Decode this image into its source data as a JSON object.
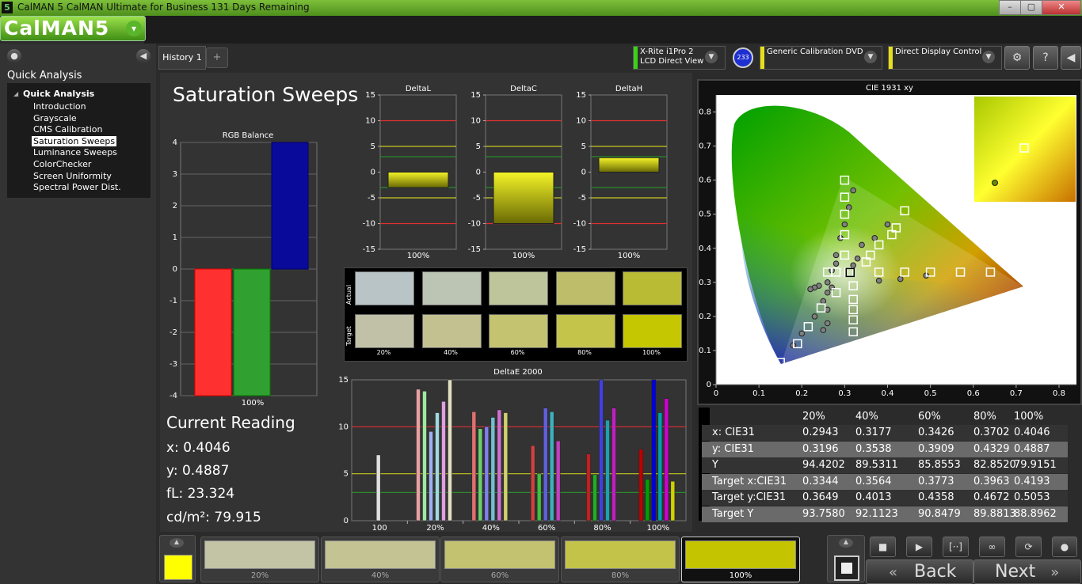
{
  "window": {
    "title": "CalMAN 5 CalMAN Ultimate for Business 131 Days Remaining",
    "app_icon": "5",
    "logo": "CalMAN5"
  },
  "sidebar": {
    "header": "Quick Analysis",
    "tree_root": "Quick Analysis",
    "items": [
      {
        "label": "Introduction"
      },
      {
        "label": "Grayscale"
      },
      {
        "label": "CMS Calibration"
      },
      {
        "label": "Saturation Sweeps",
        "selected": true
      },
      {
        "label": "Luminance Sweeps"
      },
      {
        "label": "ColorChecker"
      },
      {
        "label": "Screen Uniformity"
      },
      {
        "label": "Spectral Power Dist."
      }
    ]
  },
  "tabs": {
    "history": "History 1",
    "add": "+"
  },
  "devices": {
    "meter_line1": "X-Rite i1Pro 2",
    "meter_line2": "LCD Direct View",
    "meter_badge": "233",
    "source": "Generic Calibration DVD",
    "display": "Direct Display Control",
    "meter_color": "#3bd01a",
    "source_color": "#e6e01a",
    "display_color": "#e6e01a"
  },
  "page": {
    "title": "Saturation Sweeps"
  },
  "reading": {
    "title": "Current Reading",
    "x": "x: 0.4046",
    "y": "y: 0.4887",
    "fl": "fL: 23.324",
    "cdm2": "cd/m²: 79.915"
  },
  "rgb_chart": {
    "title": "RGB Balance",
    "ylim": [
      -4,
      4
    ],
    "ticks": [
      "4",
      "3",
      "2",
      "1",
      "0",
      "-1",
      "-2",
      "-3",
      "-4"
    ],
    "category": "100%",
    "values": {
      "red": -4,
      "green": -4,
      "blue": 4
    }
  },
  "delta_charts": {
    "ticks": [
      "15",
      "10",
      "5",
      "0",
      "-5",
      "-10",
      "-15"
    ],
    "items": [
      {
        "title": "DeltaL",
        "category": "100%",
        "value": -3
      },
      {
        "title": "DeltaC",
        "category": "100%",
        "value": -10
      },
      {
        "title": "DeltaH",
        "category": "100%",
        "value": 2.8
      }
    ]
  },
  "swatches": {
    "actual_label": "Actual",
    "target_label": "Target",
    "labels": [
      "20%",
      "40%",
      "60%",
      "80%",
      "100%"
    ],
    "actual": [
      "#b9c4c7",
      "#bcc4b4",
      "#bfc59a",
      "#bebe6a",
      "#babb35"
    ],
    "target": [
      "#c0c1a7",
      "#c3c190",
      "#c4c36f",
      "#c5c44a",
      "#c5c700"
    ]
  },
  "deltae_chart": {
    "title": "DeltaE 2000",
    "ticks": [
      "15",
      "10",
      "5",
      "0"
    ],
    "categories": [
      "100",
      "20%",
      "40%",
      "60%",
      "80%",
      "100%"
    ],
    "lines": {
      "red": 10,
      "yellow": 5,
      "green": 3
    }
  },
  "cie": {
    "title": "CIE 1931 xy",
    "xticks": [
      "0",
      "0.1",
      "0.2",
      "0.3",
      "0.4",
      "0.5",
      "0.6",
      "0.7",
      "0.8"
    ],
    "yticks": [
      "0.8",
      "0.7",
      "0.6",
      "0.5",
      "0.4",
      "0.3",
      "0.2",
      "0.1",
      "0"
    ]
  },
  "table": {
    "headers": [
      "20%",
      "40%",
      "60%",
      "80%",
      "100%"
    ],
    "rows": [
      {
        "label": "x: CIE31",
        "values": [
          "0.2943",
          "0.3177",
          "0.3426",
          "0.3702",
          "0.4046"
        ]
      },
      {
        "label": "y: CIE31",
        "values": [
          "0.3196",
          "0.3538",
          "0.3909",
          "0.4329",
          "0.4887"
        ]
      },
      {
        "label": "Y",
        "values": [
          "94.4202",
          "89.5311",
          "85.8553",
          "82.8520",
          "79.9151"
        ]
      },
      {
        "label": "Target x:CIE31",
        "values": [
          "0.3344",
          "0.3564",
          "0.3773",
          "0.3963",
          "0.4193"
        ]
      },
      {
        "label": "Target y:CIE31",
        "values": [
          "0.3649",
          "0.4013",
          "0.4358",
          "0.4672",
          "0.5053"
        ]
      },
      {
        "label": "Target Y",
        "values": [
          "93.7580",
          "92.1123",
          "90.8479",
          "89.8813",
          "88.8962"
        ]
      }
    ]
  },
  "bottom": {
    "current_color": "#ffff00",
    "swatches": [
      {
        "label": "20%",
        "color": "#c3c3a6"
      },
      {
        "label": "40%",
        "color": "#c3c393"
      },
      {
        "label": "60%",
        "color": "#c2c270"
      },
      {
        "label": "80%",
        "color": "#c3c34a"
      },
      {
        "label": "100%",
        "color": "#c4c500",
        "selected": true
      }
    ],
    "back": "Back",
    "next": "Next"
  },
  "chart_data": [
    {
      "type": "bar",
      "title": "RGB Balance",
      "categories": [
        "100%"
      ],
      "series": [
        {
          "name": "Red",
          "values": [
            -4
          ]
        },
        {
          "name": "Green",
          "values": [
            -4
          ]
        },
        {
          "name": "Blue",
          "values": [
            4
          ]
        }
      ],
      "ylim": [
        -4,
        4
      ]
    },
    {
      "type": "bar",
      "title": "DeltaL",
      "categories": [
        "100%"
      ],
      "values": [
        -3
      ],
      "ylim": [
        -15,
        15
      ]
    },
    {
      "type": "bar",
      "title": "DeltaC",
      "categories": [
        "100%"
      ],
      "values": [
        -10
      ],
      "ylim": [
        -15,
        15
      ]
    },
    {
      "type": "bar",
      "title": "DeltaH",
      "categories": [
        "100%"
      ],
      "values": [
        2.8
      ],
      "ylim": [
        -15,
        15
      ]
    },
    {
      "type": "bar",
      "title": "DeltaE 2000",
      "categories": [
        "100",
        "20%",
        "40%",
        "60%",
        "80%",
        "100%"
      ],
      "ylim": [
        0,
        15
      ],
      "groups": [
        [
          7
        ],
        [
          14,
          13.8,
          9.5,
          11.5,
          12.7,
          15
        ],
        [
          11.6,
          9.8,
          10,
          11,
          11.8,
          11.5
        ],
        [
          8,
          5,
          12,
          11.6,
          8.5
        ],
        [
          7.1,
          4.9,
          15,
          10.7,
          12
        ],
        [
          7.6,
          4.4,
          15,
          11.5,
          13,
          4.2
        ]
      ]
    },
    {
      "type": "scatter",
      "title": "CIE 1931 xy",
      "xlim": [
        0,
        0.8
      ],
      "ylim": [
        0,
        0.85
      ]
    }
  ]
}
